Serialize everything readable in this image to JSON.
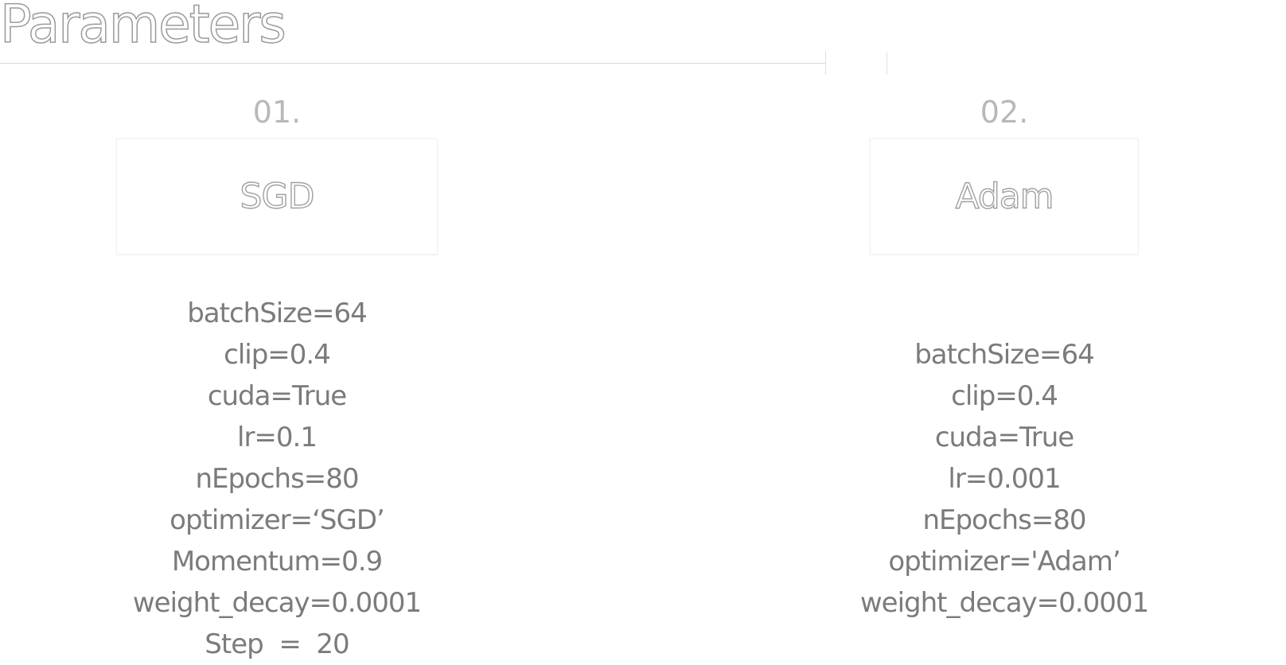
{
  "title": "Parameters",
  "columns": [
    {
      "number": "01.",
      "name": "SGD",
      "params": [
        "batchSize=64",
        "clip=0.4",
        "cuda=True",
        "lr=0.1",
        "nEpochs=80",
        "optimizer=‘SGD’",
        "Momentum=0.9",
        "weight_decay=0.0001",
        "Step  =  20"
      ]
    },
    {
      "number": "02.",
      "name": "Adam",
      "params": [
        "batchSize=64",
        "clip=0.4",
        "cuda=True",
        "lr=0.001",
        "nEpochs=80",
        "optimizer='Adam’",
        "weight_decay=0.0001"
      ]
    }
  ]
}
